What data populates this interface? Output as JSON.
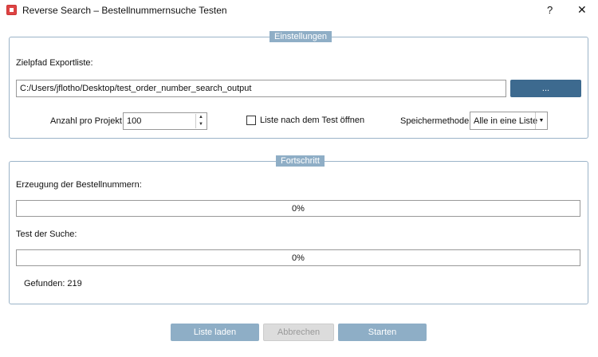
{
  "window": {
    "title": "Reverse Search – Bestellnummernsuche Testen",
    "help": "?",
    "close": "✕"
  },
  "settings": {
    "legend": "Einstellungen",
    "path_label": "Zielpfad Exportliste:",
    "path_value": "C:/Users/jflotho/Desktop/test_order_number_search_output",
    "browse": "...",
    "count_label": "Anzahl pro Projekt",
    "count_value": "100",
    "open_list_label": "Liste nach dem Test öffnen",
    "open_list_checked": false,
    "method_label": "Speichermethode",
    "method_value": "Alle in eine Liste"
  },
  "progress": {
    "legend": "Fortschritt",
    "gen_label": "Erzeugung der Bestellnummern:",
    "gen_value": "0%",
    "search_label": "Test der Suche:",
    "search_value": "0%",
    "found": "Gefunden: 219"
  },
  "buttons": {
    "load": "Liste laden",
    "cancel": "Abbrechen",
    "start": "Starten"
  }
}
